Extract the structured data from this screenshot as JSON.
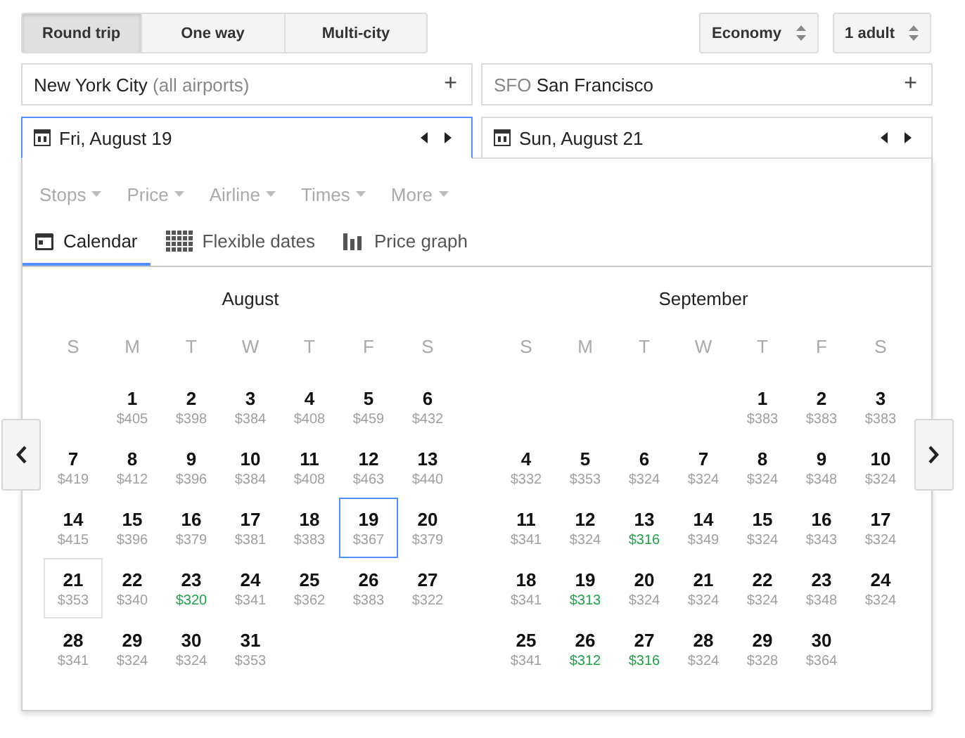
{
  "trip_types": [
    {
      "label": "Round trip",
      "selected": true
    },
    {
      "label": "One way",
      "selected": false
    },
    {
      "label": "Multi-city",
      "selected": false
    }
  ],
  "cabin_select": {
    "value": "Economy"
  },
  "passengers_select": {
    "value": "1 adult"
  },
  "origin": {
    "city": "New York City",
    "detail": "(all airports)",
    "add": "+"
  },
  "destination": {
    "code": "SFO",
    "city": "San Francisco",
    "add": "+"
  },
  "dates": [
    {
      "value": "Fri, August 19",
      "focused": true
    },
    {
      "value": "Sun, August 21",
      "focused": false
    }
  ],
  "filters": [
    {
      "label": "Stops"
    },
    {
      "label": "Price"
    },
    {
      "label": "Airline"
    },
    {
      "label": "Times"
    },
    {
      "label": "More"
    }
  ],
  "view_tabs": [
    {
      "label": "Calendar",
      "kind": "calendar",
      "selected": true
    },
    {
      "label": "Flexible dates",
      "kind": "grid",
      "selected": false
    },
    {
      "label": "Price graph",
      "kind": "bars",
      "selected": false
    }
  ],
  "months": [
    {
      "name": "August",
      "weekdays": [
        "S",
        "M",
        "T",
        "W",
        "T",
        "F",
        "S"
      ],
      "days": [
        {
          "kind": "blank"
        },
        {
          "kind": "day",
          "day": "1",
          "price": "$405",
          "cheap": false,
          "selected": false,
          "marked": false
        },
        {
          "kind": "day",
          "day": "2",
          "price": "$398",
          "cheap": false,
          "selected": false,
          "marked": false
        },
        {
          "kind": "day",
          "day": "3",
          "price": "$384",
          "cheap": false,
          "selected": false,
          "marked": false
        },
        {
          "kind": "day",
          "day": "4",
          "price": "$408",
          "cheap": false,
          "selected": false,
          "marked": false
        },
        {
          "kind": "day",
          "day": "5",
          "price": "$459",
          "cheap": false,
          "selected": false,
          "marked": false
        },
        {
          "kind": "day",
          "day": "6",
          "price": "$432",
          "cheap": false,
          "selected": false,
          "marked": false
        },
        {
          "kind": "day",
          "day": "7",
          "price": "$419",
          "cheap": false,
          "selected": false,
          "marked": false
        },
        {
          "kind": "day",
          "day": "8",
          "price": "$412",
          "cheap": false,
          "selected": false,
          "marked": false
        },
        {
          "kind": "day",
          "day": "9",
          "price": "$396",
          "cheap": false,
          "selected": false,
          "marked": false
        },
        {
          "kind": "day",
          "day": "10",
          "price": "$384",
          "cheap": false,
          "selected": false,
          "marked": false
        },
        {
          "kind": "day",
          "day": "11",
          "price": "$408",
          "cheap": false,
          "selected": false,
          "marked": false
        },
        {
          "kind": "day",
          "day": "12",
          "price": "$463",
          "cheap": false,
          "selected": false,
          "marked": false
        },
        {
          "kind": "day",
          "day": "13",
          "price": "$440",
          "cheap": false,
          "selected": false,
          "marked": false
        },
        {
          "kind": "day",
          "day": "14",
          "price": "$415",
          "cheap": false,
          "selected": false,
          "marked": false
        },
        {
          "kind": "day",
          "day": "15",
          "price": "$396",
          "cheap": false,
          "selected": false,
          "marked": false
        },
        {
          "kind": "day",
          "day": "16",
          "price": "$379",
          "cheap": false,
          "selected": false,
          "marked": false
        },
        {
          "kind": "day",
          "day": "17",
          "price": "$381",
          "cheap": false,
          "selected": false,
          "marked": false
        },
        {
          "kind": "day",
          "day": "18",
          "price": "$383",
          "cheap": false,
          "selected": false,
          "marked": false
        },
        {
          "kind": "day",
          "day": "19",
          "price": "$367",
          "cheap": false,
          "selected": true,
          "marked": false
        },
        {
          "kind": "day",
          "day": "20",
          "price": "$379",
          "cheap": false,
          "selected": false,
          "marked": false
        },
        {
          "kind": "day",
          "day": "21",
          "price": "$353",
          "cheap": false,
          "selected": false,
          "marked": true
        },
        {
          "kind": "day",
          "day": "22",
          "price": "$340",
          "cheap": false,
          "selected": false,
          "marked": false
        },
        {
          "kind": "day",
          "day": "23",
          "price": "$320",
          "cheap": true,
          "selected": false,
          "marked": false
        },
        {
          "kind": "day",
          "day": "24",
          "price": "$341",
          "cheap": false,
          "selected": false,
          "marked": false
        },
        {
          "kind": "day",
          "day": "25",
          "price": "$362",
          "cheap": false,
          "selected": false,
          "marked": false
        },
        {
          "kind": "day",
          "day": "26",
          "price": "$383",
          "cheap": false,
          "selected": false,
          "marked": false
        },
        {
          "kind": "day",
          "day": "27",
          "price": "$322",
          "cheap": false,
          "selected": false,
          "marked": false
        },
        {
          "kind": "day",
          "day": "28",
          "price": "$341",
          "cheap": false,
          "selected": false,
          "marked": false
        },
        {
          "kind": "day",
          "day": "29",
          "price": "$324",
          "cheap": false,
          "selected": false,
          "marked": false
        },
        {
          "kind": "day",
          "day": "30",
          "price": "$324",
          "cheap": false,
          "selected": false,
          "marked": false
        },
        {
          "kind": "day",
          "day": "31",
          "price": "$353",
          "cheap": false,
          "selected": false,
          "marked": false
        }
      ]
    },
    {
      "name": "September",
      "weekdays": [
        "S",
        "M",
        "T",
        "W",
        "T",
        "F",
        "S"
      ],
      "days": [
        {
          "kind": "blank"
        },
        {
          "kind": "blank"
        },
        {
          "kind": "blank"
        },
        {
          "kind": "blank"
        },
        {
          "kind": "day",
          "day": "1",
          "price": "$383",
          "cheap": false,
          "selected": false,
          "marked": false
        },
        {
          "kind": "day",
          "day": "2",
          "price": "$383",
          "cheap": false,
          "selected": false,
          "marked": false
        },
        {
          "kind": "day",
          "day": "3",
          "price": "$383",
          "cheap": false,
          "selected": false,
          "marked": false
        },
        {
          "kind": "day",
          "day": "4",
          "price": "$332",
          "cheap": false,
          "selected": false,
          "marked": false
        },
        {
          "kind": "day",
          "day": "5",
          "price": "$353",
          "cheap": false,
          "selected": false,
          "marked": false
        },
        {
          "kind": "day",
          "day": "6",
          "price": "$324",
          "cheap": false,
          "selected": false,
          "marked": false
        },
        {
          "kind": "day",
          "day": "7",
          "price": "$324",
          "cheap": false,
          "selected": false,
          "marked": false
        },
        {
          "kind": "day",
          "day": "8",
          "price": "$324",
          "cheap": false,
          "selected": false,
          "marked": false
        },
        {
          "kind": "day",
          "day": "9",
          "price": "$348",
          "cheap": false,
          "selected": false,
          "marked": false
        },
        {
          "kind": "day",
          "day": "10",
          "price": "$324",
          "cheap": false,
          "selected": false,
          "marked": false
        },
        {
          "kind": "day",
          "day": "11",
          "price": "$341",
          "cheap": false,
          "selected": false,
          "marked": false
        },
        {
          "kind": "day",
          "day": "12",
          "price": "$324",
          "cheap": false,
          "selected": false,
          "marked": false
        },
        {
          "kind": "day",
          "day": "13",
          "price": "$316",
          "cheap": true,
          "selected": false,
          "marked": false
        },
        {
          "kind": "day",
          "day": "14",
          "price": "$349",
          "cheap": false,
          "selected": false,
          "marked": false
        },
        {
          "kind": "day",
          "day": "15",
          "price": "$324",
          "cheap": false,
          "selected": false,
          "marked": false
        },
        {
          "kind": "day",
          "day": "16",
          "price": "$343",
          "cheap": false,
          "selected": false,
          "marked": false
        },
        {
          "kind": "day",
          "day": "17",
          "price": "$324",
          "cheap": false,
          "selected": false,
          "marked": false
        },
        {
          "kind": "day",
          "day": "18",
          "price": "$341",
          "cheap": false,
          "selected": false,
          "marked": false
        },
        {
          "kind": "day",
          "day": "19",
          "price": "$313",
          "cheap": true,
          "selected": false,
          "marked": false
        },
        {
          "kind": "day",
          "day": "20",
          "price": "$324",
          "cheap": false,
          "selected": false,
          "marked": false
        },
        {
          "kind": "day",
          "day": "21",
          "price": "$324",
          "cheap": false,
          "selected": false,
          "marked": false
        },
        {
          "kind": "day",
          "day": "22",
          "price": "$324",
          "cheap": false,
          "selected": false,
          "marked": false
        },
        {
          "kind": "day",
          "day": "23",
          "price": "$348",
          "cheap": false,
          "selected": false,
          "marked": false
        },
        {
          "kind": "day",
          "day": "24",
          "price": "$324",
          "cheap": false,
          "selected": false,
          "marked": false
        },
        {
          "kind": "day",
          "day": "25",
          "price": "$341",
          "cheap": false,
          "selected": false,
          "marked": false
        },
        {
          "kind": "day",
          "day": "26",
          "price": "$312",
          "cheap": true,
          "selected": false,
          "marked": false
        },
        {
          "kind": "day",
          "day": "27",
          "price": "$316",
          "cheap": true,
          "selected": false,
          "marked": false
        },
        {
          "kind": "day",
          "day": "28",
          "price": "$324",
          "cheap": false,
          "selected": false,
          "marked": false
        },
        {
          "kind": "day",
          "day": "29",
          "price": "$328",
          "cheap": false,
          "selected": false,
          "marked": false
        },
        {
          "kind": "day",
          "day": "30",
          "price": "$364",
          "cheap": false,
          "selected": false,
          "marked": false
        }
      ]
    }
  ]
}
